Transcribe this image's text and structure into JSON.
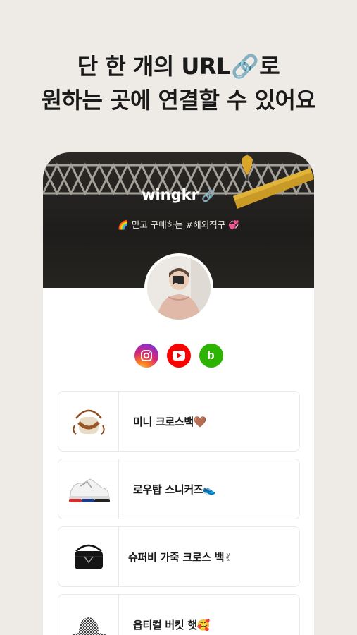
{
  "headline": {
    "line1_text": "단 한 개의 URL",
    "line1_emoji": "🔗",
    "line1_suffix": "로",
    "line2": "원하는 곳에 연결할 수 있어요"
  },
  "profile": {
    "name": "wingkr",
    "name_emoji": "🔗",
    "bio": "🌈 믿고 구매하는 #해외직구 💞"
  },
  "socials": [
    {
      "name": "instagram-icon"
    },
    {
      "name": "youtube-icon"
    },
    {
      "name": "blog-icon",
      "glyph": "b"
    }
  ],
  "links": [
    {
      "label": "미니 크로스백🤎",
      "thumb": "crossbag-icon"
    },
    {
      "label": "로우탑 스니커즈👟",
      "thumb": "sneaker-icon"
    },
    {
      "label": "슈퍼비 가죽 크로스 백✌",
      "thumb": "leather-bag-icon"
    },
    {
      "label": "옵티컬 버킷 햇🥰",
      "thumb": "bucket-hat-icon"
    }
  ],
  "colors": {
    "background": "#eeebe6",
    "hero": "#2b2926",
    "instagram": "#d62976",
    "youtube": "#ff0000",
    "blog": "#2db400"
  }
}
